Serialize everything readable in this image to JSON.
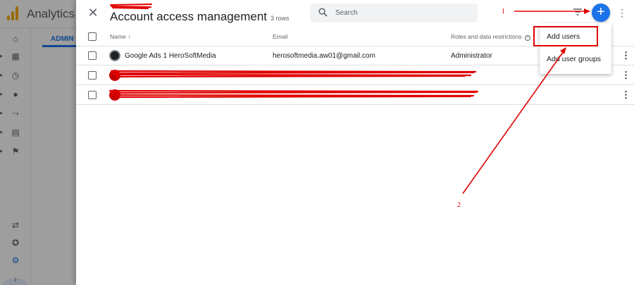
{
  "app": {
    "title": "Analytics",
    "admin_tab_label": "ADMIN",
    "brand_color": "#f9ab00",
    "accent_color": "#1a73e8"
  },
  "nav_rail": {
    "icons": [
      "home-icon",
      "dashboard-icon",
      "clock-icon",
      "person-icon",
      "flow-icon",
      "table-icon",
      "flag-icon"
    ],
    "bottom_icons": [
      "connect-icon",
      "lightbulb-icon",
      "gear-icon",
      "expand-icon"
    ]
  },
  "panel": {
    "title": "Account access management",
    "row_count": "3 rows",
    "search_placeholder": "Search",
    "add_button_glyph": "+"
  },
  "table": {
    "columns": {
      "name": "Name",
      "sort_indicator": "↑",
      "email": "Email",
      "roles": "Roles and data restrictions"
    },
    "rows": [
      {
        "name": "Google Ads 1 HeroSoftMedia",
        "email": "herosoftmedia.aw01@gmail.com",
        "role": "Administrator",
        "redacted": false
      },
      {
        "name": "",
        "email": "",
        "role": "",
        "redacted": true
      },
      {
        "name": "",
        "email": "",
        "role": "",
        "redacted": true
      }
    ]
  },
  "menu": {
    "items": [
      "Add users",
      "Add user groups"
    ]
  },
  "annotations": {
    "label_1": "1",
    "label_2": "2",
    "color": "#e00000"
  }
}
